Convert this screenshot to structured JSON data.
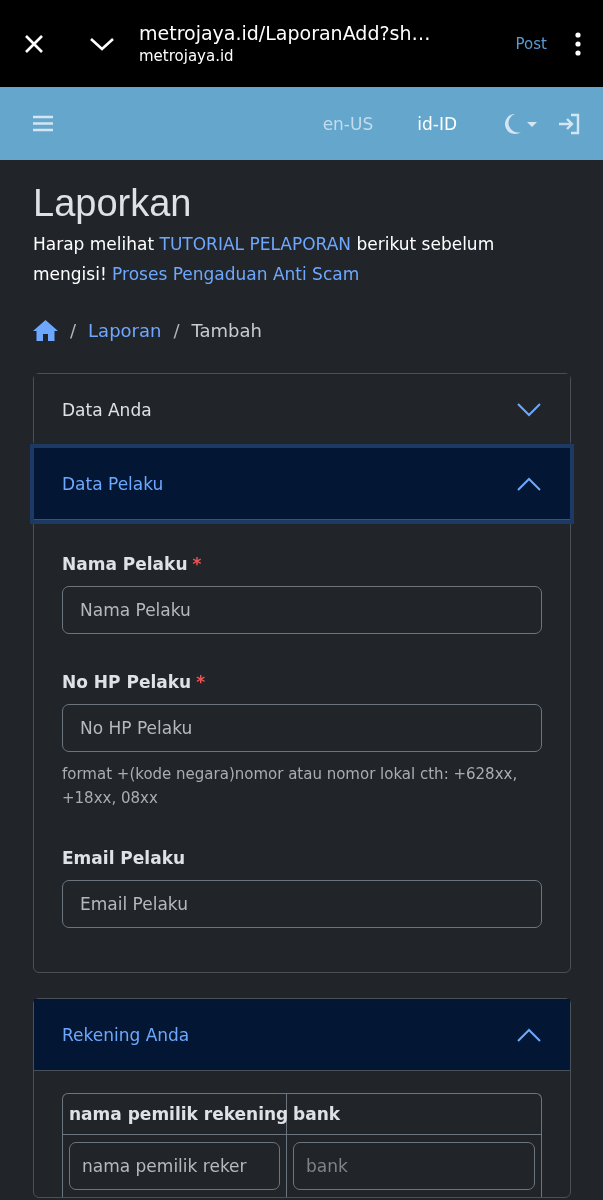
{
  "browser_bar": {
    "url": "metrojaya.id/LaporanAdd?sh…",
    "domain": "metrojaya.id",
    "action": "Post"
  },
  "navbar": {
    "languages": [
      {
        "label": "en-US",
        "selected": false
      },
      {
        "label": "id-ID",
        "selected": true
      }
    ]
  },
  "page": {
    "title": "Laporkan",
    "intro": [
      {
        "kind": "text",
        "text": "Harap melihat "
      },
      {
        "kind": "link",
        "text": "TUTORIAL PELAPORAN"
      },
      {
        "kind": "text",
        "text": " berikut sebelum mengisi! "
      },
      {
        "kind": "link",
        "text": "Proses Pengaduan Anti Scam"
      }
    ]
  },
  "breadcrumb": [
    {
      "separator": "/",
      "label": "Laporan",
      "kind": "link"
    },
    {
      "separator": "/",
      "label": "Tambah",
      "kind": "current"
    }
  ],
  "sections": [
    {
      "title": "Data Anda",
      "expanded": false,
      "focused": false
    },
    {
      "title": "Data Pelaku",
      "expanded": true,
      "focused": true,
      "fields": [
        {
          "label": "Nama Pelaku",
          "required_mark": "*",
          "placeholder": "Nama Pelaku"
        },
        {
          "label": "No HP Pelaku",
          "required_mark": "*",
          "placeholder": "No HP Pelaku",
          "help": "format +(kode negara)nomor atau nomor lokal cth: +628xx, +18xx, 08xx"
        },
        {
          "label": "Email Pelaku",
          "placeholder": "Email Pelaku"
        }
      ]
    },
    {
      "title": "Rekening Anda",
      "expanded": true,
      "focused": false,
      "table": {
        "columns": [
          "nama pemilik rekening",
          "bank"
        ],
        "placeholders": [
          "nama pemilik reker",
          "bank"
        ]
      }
    }
  ]
}
